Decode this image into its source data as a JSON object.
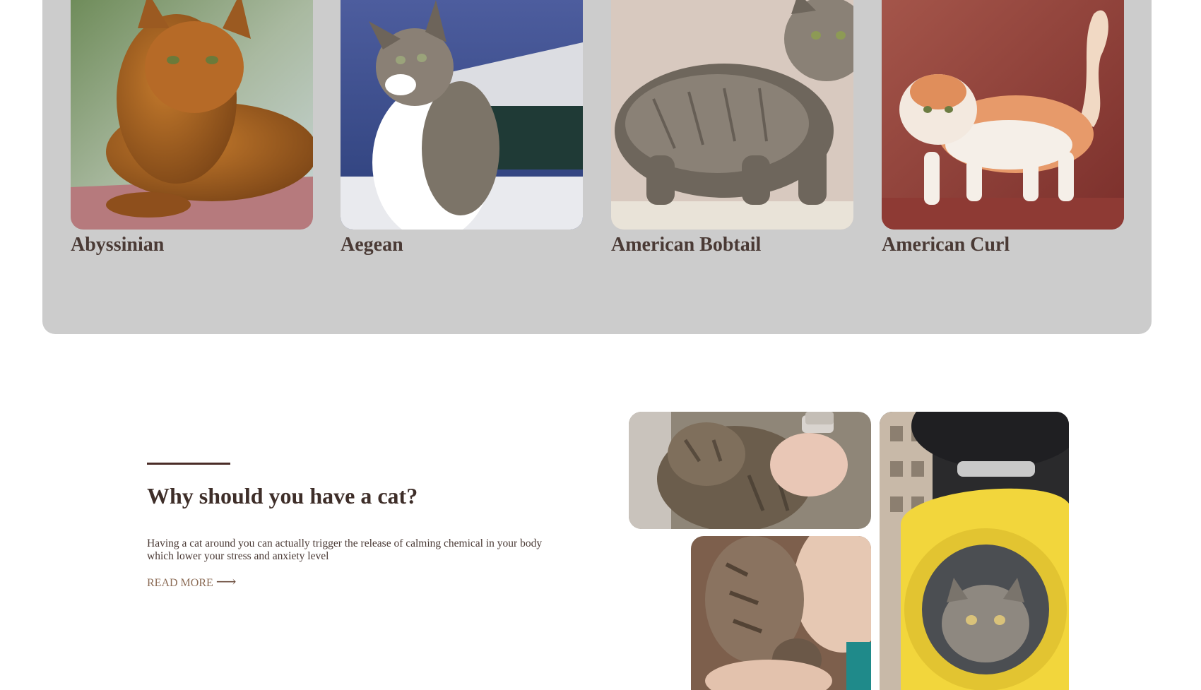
{
  "breeds": [
    {
      "name": "Abyssinian",
      "photo_icon": "abyssinian-cat-photo"
    },
    {
      "name": "Aegean",
      "photo_icon": "aegean-cat-photo"
    },
    {
      "name": "American Bobtail",
      "photo_icon": "american-bobtail-cat-photo"
    },
    {
      "name": "American Curl",
      "photo_icon": "american-curl-cat-photo"
    }
  ],
  "why": {
    "title": "Why should you have a cat?",
    "text": "Having a cat around you can actually trigger the release of calming chemical in your body which lower your stress and anxiety level",
    "read_more": "READ MORE",
    "arrow": "⟶"
  },
  "colors": {
    "panel": "#cccccc",
    "heading": "#3e2e29",
    "accent": "#4a2c27",
    "link": "#8b6b55"
  }
}
